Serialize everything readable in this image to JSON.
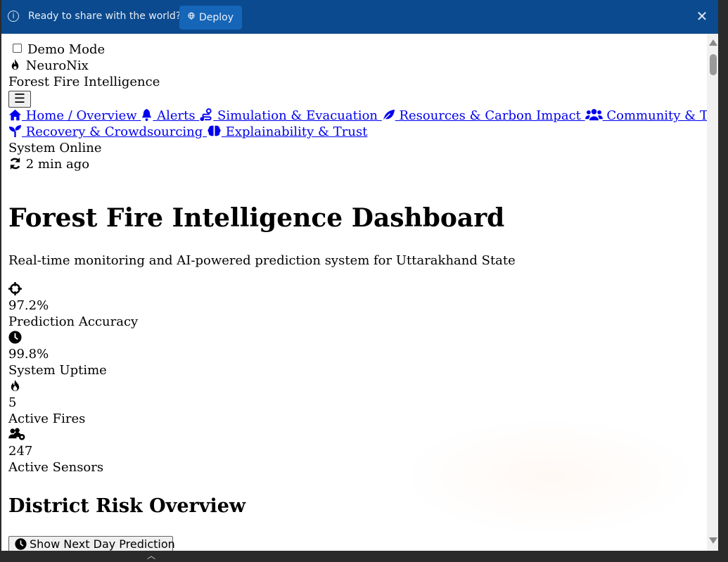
{
  "banner": {
    "message": "Ready to share with the world?",
    "deploy_label": "Deploy",
    "info_icon": "i",
    "close_icon": "✕"
  },
  "demo_mode": {
    "label": "Demo Mode",
    "checked": false
  },
  "brand": {
    "name": "NeuroNix",
    "tagline": "Forest Fire Intelligence"
  },
  "menu_toggle": "☰",
  "nav": [
    {
      "label": " Home / Overview ",
      "icon": "home-icon"
    },
    {
      "label": " Alerts ",
      "icon": "bell-icon"
    },
    {
      "label": " Simulation & Evacuation ",
      "icon": "route-icon"
    },
    {
      "label": " Resources & Carbon Impact ",
      "icon": "leaf-icon"
    },
    {
      "label": " Community & Training",
      "icon": "users-icon"
    },
    {
      "label": " Recovery & Crowdsourcing ",
      "icon": "seedling-icon"
    },
    {
      "label": " Explainability & Trust",
      "icon": "brain-icon"
    }
  ],
  "status": {
    "text": "System Online",
    "updated": "2 min ago"
  },
  "page": {
    "title": "Forest Fire Intelligence Dashboard",
    "subtitle": "Real-time monitoring and AI-powered prediction system for Uttarakhand State"
  },
  "stats": [
    {
      "value": "97.2%",
      "label": "Prediction Accuracy",
      "icon": "crosshairs-icon"
    },
    {
      "value": "99.8%",
      "label": "System Uptime",
      "icon": "clock-icon"
    },
    {
      "value": "5",
      "label": "Active Fires",
      "icon": "fire-icon"
    },
    {
      "value": "247",
      "label": "Active Sensors",
      "icon": "users-cog-icon"
    }
  ],
  "district": {
    "heading": "District Risk Overview",
    "button_label": "Show Next Day Prediction"
  }
}
